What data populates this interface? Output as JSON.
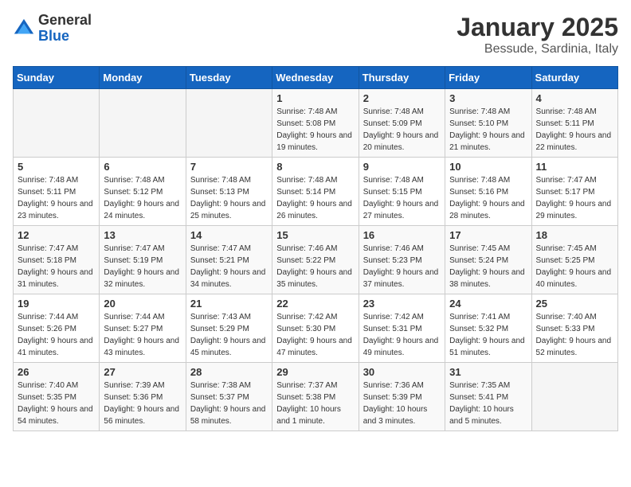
{
  "header": {
    "logo_general": "General",
    "logo_blue": "Blue",
    "month_title": "January 2025",
    "location": "Bessude, Sardinia, Italy"
  },
  "weekdays": [
    "Sunday",
    "Monday",
    "Tuesday",
    "Wednesday",
    "Thursday",
    "Friday",
    "Saturday"
  ],
  "weeks": [
    [
      {
        "day": "",
        "sunrise": "",
        "sunset": "",
        "daylight": ""
      },
      {
        "day": "",
        "sunrise": "",
        "sunset": "",
        "daylight": ""
      },
      {
        "day": "",
        "sunrise": "",
        "sunset": "",
        "daylight": ""
      },
      {
        "day": "1",
        "sunrise": "Sunrise: 7:48 AM",
        "sunset": "Sunset: 5:08 PM",
        "daylight": "Daylight: 9 hours and 19 minutes."
      },
      {
        "day": "2",
        "sunrise": "Sunrise: 7:48 AM",
        "sunset": "Sunset: 5:09 PM",
        "daylight": "Daylight: 9 hours and 20 minutes."
      },
      {
        "day": "3",
        "sunrise": "Sunrise: 7:48 AM",
        "sunset": "Sunset: 5:10 PM",
        "daylight": "Daylight: 9 hours and 21 minutes."
      },
      {
        "day": "4",
        "sunrise": "Sunrise: 7:48 AM",
        "sunset": "Sunset: 5:11 PM",
        "daylight": "Daylight: 9 hours and 22 minutes."
      }
    ],
    [
      {
        "day": "5",
        "sunrise": "Sunrise: 7:48 AM",
        "sunset": "Sunset: 5:11 PM",
        "daylight": "Daylight: 9 hours and 23 minutes."
      },
      {
        "day": "6",
        "sunrise": "Sunrise: 7:48 AM",
        "sunset": "Sunset: 5:12 PM",
        "daylight": "Daylight: 9 hours and 24 minutes."
      },
      {
        "day": "7",
        "sunrise": "Sunrise: 7:48 AM",
        "sunset": "Sunset: 5:13 PM",
        "daylight": "Daylight: 9 hours and 25 minutes."
      },
      {
        "day": "8",
        "sunrise": "Sunrise: 7:48 AM",
        "sunset": "Sunset: 5:14 PM",
        "daylight": "Daylight: 9 hours and 26 minutes."
      },
      {
        "day": "9",
        "sunrise": "Sunrise: 7:48 AM",
        "sunset": "Sunset: 5:15 PM",
        "daylight": "Daylight: 9 hours and 27 minutes."
      },
      {
        "day": "10",
        "sunrise": "Sunrise: 7:48 AM",
        "sunset": "Sunset: 5:16 PM",
        "daylight": "Daylight: 9 hours and 28 minutes."
      },
      {
        "day": "11",
        "sunrise": "Sunrise: 7:47 AM",
        "sunset": "Sunset: 5:17 PM",
        "daylight": "Daylight: 9 hours and 29 minutes."
      }
    ],
    [
      {
        "day": "12",
        "sunrise": "Sunrise: 7:47 AM",
        "sunset": "Sunset: 5:18 PM",
        "daylight": "Daylight: 9 hours and 31 minutes."
      },
      {
        "day": "13",
        "sunrise": "Sunrise: 7:47 AM",
        "sunset": "Sunset: 5:19 PM",
        "daylight": "Daylight: 9 hours and 32 minutes."
      },
      {
        "day": "14",
        "sunrise": "Sunrise: 7:47 AM",
        "sunset": "Sunset: 5:21 PM",
        "daylight": "Daylight: 9 hours and 34 minutes."
      },
      {
        "day": "15",
        "sunrise": "Sunrise: 7:46 AM",
        "sunset": "Sunset: 5:22 PM",
        "daylight": "Daylight: 9 hours and 35 minutes."
      },
      {
        "day": "16",
        "sunrise": "Sunrise: 7:46 AM",
        "sunset": "Sunset: 5:23 PM",
        "daylight": "Daylight: 9 hours and 37 minutes."
      },
      {
        "day": "17",
        "sunrise": "Sunrise: 7:45 AM",
        "sunset": "Sunset: 5:24 PM",
        "daylight": "Daylight: 9 hours and 38 minutes."
      },
      {
        "day": "18",
        "sunrise": "Sunrise: 7:45 AM",
        "sunset": "Sunset: 5:25 PM",
        "daylight": "Daylight: 9 hours and 40 minutes."
      }
    ],
    [
      {
        "day": "19",
        "sunrise": "Sunrise: 7:44 AM",
        "sunset": "Sunset: 5:26 PM",
        "daylight": "Daylight: 9 hours and 41 minutes."
      },
      {
        "day": "20",
        "sunrise": "Sunrise: 7:44 AM",
        "sunset": "Sunset: 5:27 PM",
        "daylight": "Daylight: 9 hours and 43 minutes."
      },
      {
        "day": "21",
        "sunrise": "Sunrise: 7:43 AM",
        "sunset": "Sunset: 5:29 PM",
        "daylight": "Daylight: 9 hours and 45 minutes."
      },
      {
        "day": "22",
        "sunrise": "Sunrise: 7:42 AM",
        "sunset": "Sunset: 5:30 PM",
        "daylight": "Daylight: 9 hours and 47 minutes."
      },
      {
        "day": "23",
        "sunrise": "Sunrise: 7:42 AM",
        "sunset": "Sunset: 5:31 PM",
        "daylight": "Daylight: 9 hours and 49 minutes."
      },
      {
        "day": "24",
        "sunrise": "Sunrise: 7:41 AM",
        "sunset": "Sunset: 5:32 PM",
        "daylight": "Daylight: 9 hours and 51 minutes."
      },
      {
        "day": "25",
        "sunrise": "Sunrise: 7:40 AM",
        "sunset": "Sunset: 5:33 PM",
        "daylight": "Daylight: 9 hours and 52 minutes."
      }
    ],
    [
      {
        "day": "26",
        "sunrise": "Sunrise: 7:40 AM",
        "sunset": "Sunset: 5:35 PM",
        "daylight": "Daylight: 9 hours and 54 minutes."
      },
      {
        "day": "27",
        "sunrise": "Sunrise: 7:39 AM",
        "sunset": "Sunset: 5:36 PM",
        "daylight": "Daylight: 9 hours and 56 minutes."
      },
      {
        "day": "28",
        "sunrise": "Sunrise: 7:38 AM",
        "sunset": "Sunset: 5:37 PM",
        "daylight": "Daylight: 9 hours and 58 minutes."
      },
      {
        "day": "29",
        "sunrise": "Sunrise: 7:37 AM",
        "sunset": "Sunset: 5:38 PM",
        "daylight": "Daylight: 10 hours and 1 minute."
      },
      {
        "day": "30",
        "sunrise": "Sunrise: 7:36 AM",
        "sunset": "Sunset: 5:39 PM",
        "daylight": "Daylight: 10 hours and 3 minutes."
      },
      {
        "day": "31",
        "sunrise": "Sunrise: 7:35 AM",
        "sunset": "Sunset: 5:41 PM",
        "daylight": "Daylight: 10 hours and 5 minutes."
      },
      {
        "day": "",
        "sunrise": "",
        "sunset": "",
        "daylight": ""
      }
    ]
  ]
}
